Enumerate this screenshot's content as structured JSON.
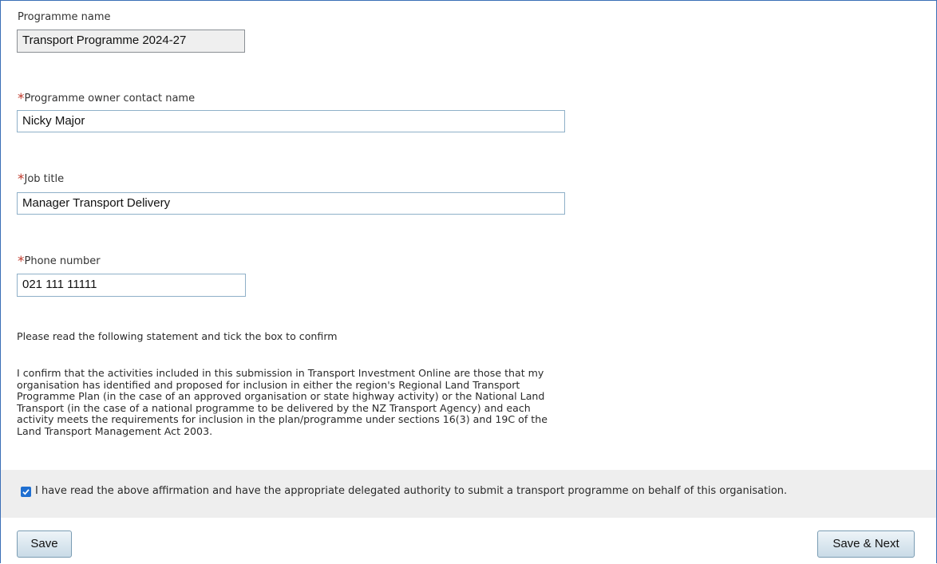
{
  "programme_name": {
    "label": "Programme name",
    "value": "Transport Programme 2024-27"
  },
  "owner_contact": {
    "required_mark": "*",
    "label": "Programme owner contact name",
    "value": "Nicky Major"
  },
  "job_title": {
    "required_mark": "*",
    "label": "Job title",
    "value": "Manager Transport Delivery"
  },
  "phone": {
    "required_mark": "*",
    "label": "Phone number",
    "value": "021 111 11111"
  },
  "instruction": "Please read the following statement and tick the box to confirm",
  "statement_lines": [
    "I confirm that the activities included in this submission in Transport Investment Online are those that my",
    "organisation has identified and proposed for inclusion in either the region's Regional Land Transport",
    "Programme Plan (in the case of an approved organisation or state highway activity) or the National Land",
    "Transport (in the case of a national programme to be delivered by the NZ Transport Agency) and each",
    "activity meets the requirements for inclusion in the plan/programme under sections 16(3) and 19C of the",
    "Land Transport Management Act 2003."
  ],
  "affirmation": {
    "checked": true,
    "label": "I have read the above affirmation and have the appropriate delegated authority to submit a transport programme on behalf of this organisation."
  },
  "buttons": {
    "save": "Save",
    "save_next": "Save & Next"
  },
  "colors": {
    "required": "#c0392b",
    "checkbox": "#1f6fd1",
    "frame_border": "#3b6fb6"
  }
}
